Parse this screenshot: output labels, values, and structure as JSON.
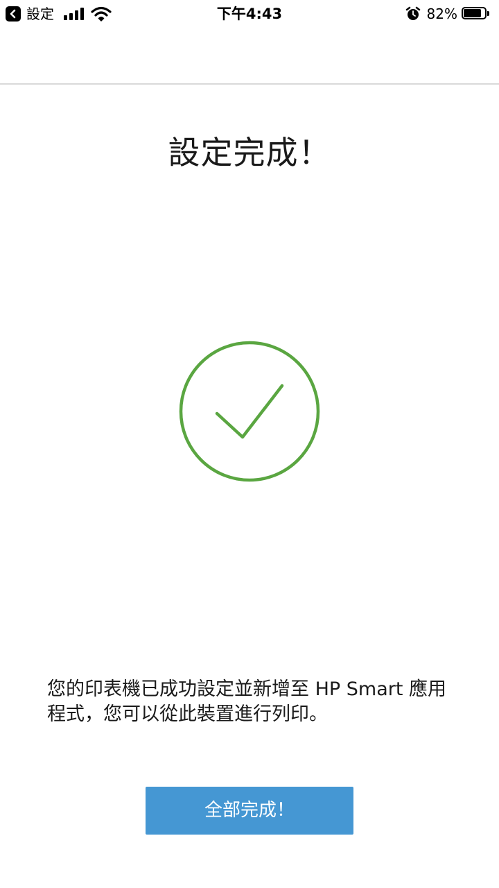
{
  "status_bar": {
    "back_app": "設定",
    "time": "下午4:43",
    "battery_percent": "82%",
    "battery_level": 0.82,
    "icons": {
      "back": "back-chevron-icon",
      "signal": "cellular-signal-icon",
      "wifi": "wifi-icon",
      "alarm": "alarm-clock-icon",
      "battery": "battery-icon"
    }
  },
  "main": {
    "title": "設定完成！",
    "success_icon": "checkmark-circle-icon",
    "message": "您的印表機已成功設定並新增至 HP Smart 應用程式，您可以從此裝置進行列印。",
    "done_button_label": "全部完成！"
  },
  "colors": {
    "accent_green": "#5aa641",
    "button_blue": "#4597d3",
    "divider": "#d9d9d9"
  }
}
